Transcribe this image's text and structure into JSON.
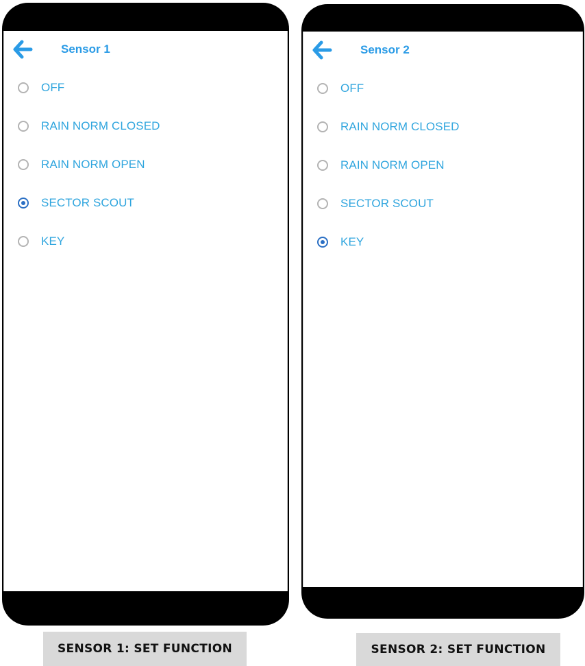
{
  "panels": [
    {
      "title": "Sensor 1",
      "options": [
        "OFF",
        "RAIN NORM CLOSED",
        "RAIN NORM OPEN",
        "SECTOR SCOUT",
        "KEY"
      ],
      "selected_label": "SECTOR SCOUT",
      "caption": "SENSOR 1: SET FUNCTION"
    },
    {
      "title": "Sensor 2",
      "options": [
        "OFF",
        "RAIN NORM CLOSED",
        "RAIN NORM OPEN",
        "SECTOR SCOUT",
        "KEY"
      ],
      "selected_label": "KEY",
      "caption": "SENSOR 2: SET FUNCTION"
    }
  ],
  "icons": {
    "back": "arrow-left-icon"
  },
  "colors": {
    "accent": "#2a9be6",
    "label": "#2fa5de",
    "radio_checked": "#2a6fc4",
    "radio_unchecked": "#b3b3b3"
  }
}
